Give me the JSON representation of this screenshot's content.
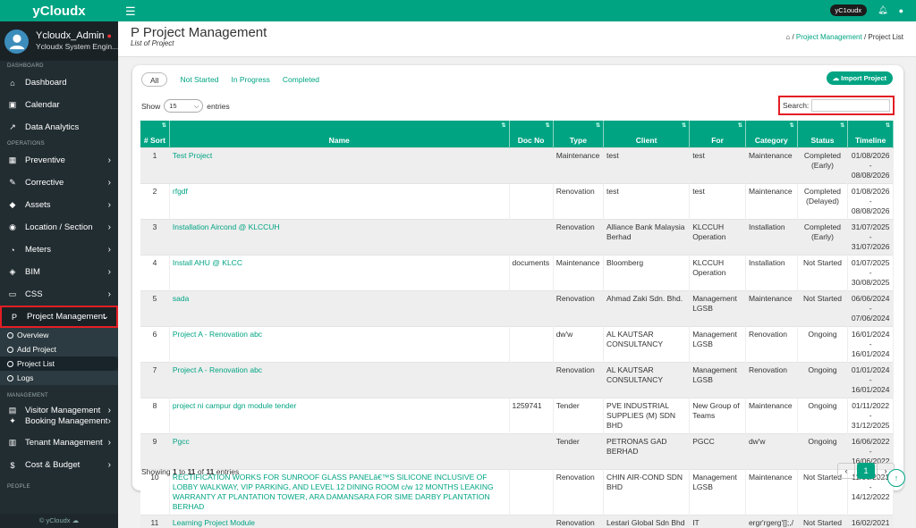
{
  "brand": "yCloudx",
  "user": {
    "name": "Ycloudx_Admin",
    "role": "Ycloudx System Engin..."
  },
  "topbar": {
    "badge": "yC1oudx"
  },
  "sidebar": {
    "sections": {
      "dashboard": "DASHBOARD",
      "operations": "OPERATIONS",
      "management": "MANAGEMENT",
      "people": "PEOPLE"
    },
    "dash_items": [
      {
        "label": "Dashboard",
        "icon": "home-icon"
      },
      {
        "label": "Calendar",
        "icon": "calendar-icon"
      },
      {
        "label": "Data Analytics",
        "icon": "chart-icon"
      }
    ],
    "ops_items": [
      {
        "label": "Preventive",
        "icon": "calendar-grid-icon"
      },
      {
        "label": "Corrective",
        "icon": "wrench-icon"
      },
      {
        "label": "Assets",
        "icon": "tag-icon"
      },
      {
        "label": "Location / Section",
        "icon": "location-icon"
      },
      {
        "label": "Meters",
        "icon": "gauge-icon"
      },
      {
        "label": "BIM",
        "icon": "cube-icon"
      },
      {
        "label": "CSS",
        "icon": "monitor-icon"
      }
    ],
    "active": {
      "label": "Project Management",
      "icon": "project-icon"
    },
    "subs": [
      "Overview",
      "Add Project",
      "Project List",
      "Logs"
    ],
    "mgmt_items": [
      {
        "label": "Visitor Management",
        "icon": "id-card-icon"
      },
      {
        "label": "Booking Management",
        "icon": "pin-icon"
      },
      {
        "label": "Tenant Management",
        "icon": "building-icon"
      },
      {
        "label": "Cost & Budget",
        "icon": "dollar-icon"
      }
    ],
    "copyright": "© yCloudx"
  },
  "page": {
    "title": "Project Management",
    "subtitle": "List of Project",
    "bc_link": "Project Management",
    "bc_sep": "/",
    "bc_cur": "Project List"
  },
  "tabs": [
    "All",
    "Not Started",
    "In Progress",
    "Completed"
  ],
  "import_label": "Import Project",
  "show": {
    "pre": "Show",
    "value": "15",
    "post": "entries"
  },
  "search_label": "Search:",
  "columns": [
    "# Sort",
    "Name",
    "Doc No",
    "Type",
    "Client",
    "For",
    "Category",
    "Status",
    "Timeline"
  ],
  "rows": [
    [
      "1",
      "Test Project",
      "",
      "Maintenance",
      "test",
      "test",
      "Maintenance",
      "Completed (Early)",
      "01/08/2026 - 08/08/2026"
    ],
    [
      "2",
      "rfgdf",
      "",
      "Renovation",
      "test",
      "test",
      "Maintenance",
      "Completed (Delayed)",
      "01/08/2026 - 08/08/2026"
    ],
    [
      "3",
      "Installation Aircond @ KLCCUH",
      "",
      "Renovation",
      "Alliance Bank Malaysia Berhad",
      "KLCCUH Operation",
      "Installation",
      "Completed (Early)",
      "31/07/2025 - 31/07/2026"
    ],
    [
      "4",
      "Install AHU @ KLCC",
      "documents",
      "Maintenance",
      "Bloomberg",
      "KLCCUH Operation",
      "Installation",
      "Not Started",
      "01/07/2025 - 30/08/2025"
    ],
    [
      "5",
      "sada",
      "",
      "Renovation",
      "Ahmad Zaki Sdn. Bhd.",
      "Management LGSB",
      "Maintenance",
      "Not Started",
      "06/06/2024 - 07/06/2024"
    ],
    [
      "6",
      "Project A - Renovation abc",
      "",
      "dw'w",
      "AL KAUTSAR CONSULTANCY",
      "Management LGSB",
      "Renovation",
      "Ongoing",
      "16/01/2024 - 16/01/2024"
    ],
    [
      "7",
      "Project A - Renovation abc",
      "",
      "Renovation",
      "AL KAUTSAR CONSULTANCY",
      "Management LGSB",
      "Renovation",
      "Ongoing",
      "01/01/2024 - 16/01/2024"
    ],
    [
      "8",
      "project ni campur dgn module tender",
      "1259741",
      "Tender",
      "PVE INDUSTRIAL SUPPLIES (M) SDN BHD",
      "New Group of Teams",
      "Maintenance",
      "Ongoing",
      "01/11/2022 - 31/12/2025"
    ],
    [
      "9",
      "Pgcc",
      "",
      "Tender",
      "PETRONAS GAD BERHAD",
      "PGCC",
      "dw'w",
      "Ongoing",
      "16/06/2022 - 16/06/2022"
    ],
    [
      "10",
      "RECTIFICATION WORKS FOR SUNROOF GLASS PANELâ€™S SILICONE INCLUSIVE OF LOBBY WALKWAY, VIP PARKING, AND LEVEL 12 DINING ROOM c/w 12 MONTHS LEAKING WARRANTY AT PLANTATION TOWER, ARA DAMANSARA FOR SIME DARBY PLANTATION BERHAD",
      "",
      "Renovation",
      "CHIN AIR-COND SDN BHD",
      "Management LGSB",
      "Maintenance",
      "Not Started",
      "11/06/2021 - 14/12/2022"
    ],
    [
      "11",
      "Learning Project Module",
      "",
      "Renovation",
      "Lestari Global Sdn Bhd",
      "IT",
      "ergr'rgerg'[];,/",
      "Not Started",
      "16/02/2021 - 31/03/2021"
    ]
  ],
  "footer": {
    "a": "Showing ",
    "b": "1",
    "c": " to ",
    "d": "11",
    "e": " of ",
    "f": "11",
    "g": " entries"
  },
  "pager": {
    "prev": "‹",
    "page": "1",
    "next": "›"
  }
}
